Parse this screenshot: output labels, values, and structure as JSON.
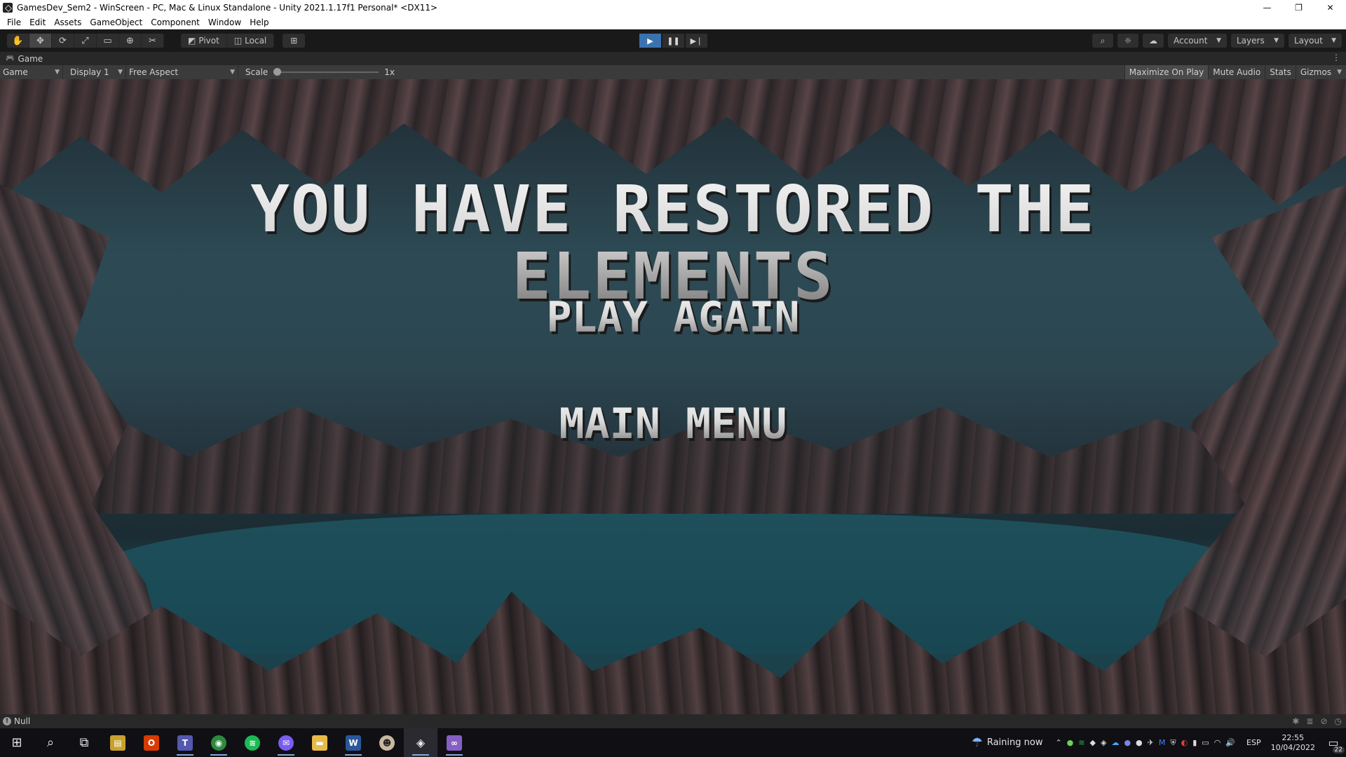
{
  "window": {
    "title": "GamesDev_Sem2 - WinScreen - PC, Mac & Linux Standalone - Unity 2021.1.17f1 Personal* <DX11>",
    "controls": {
      "minimize": "—",
      "restore": "❐",
      "close": "✕"
    }
  },
  "menubar": {
    "items": [
      {
        "label": "File"
      },
      {
        "label": "Edit"
      },
      {
        "label": "Assets"
      },
      {
        "label": "GameObject"
      },
      {
        "label": "Component"
      },
      {
        "label": "Window"
      },
      {
        "label": "Help"
      }
    ]
  },
  "toolbar": {
    "tools": [
      "hand-tool",
      "move-tool",
      "rotate-tool",
      "scale-tool",
      "rect-tool",
      "transform-tool",
      "custom-tool"
    ],
    "tool_glyphs": [
      "✋",
      "✥",
      "⟳",
      "⤢",
      "▭",
      "⊕",
      "✂"
    ],
    "active_tool_index": 1,
    "pivot_label": "Pivot",
    "local_label": "Local",
    "grid_glyph": "⊞",
    "play_glyphs": {
      "play": "▶",
      "pause": "❚❚",
      "step": "▶❘"
    },
    "play_active": true,
    "search_glyph": "⌕",
    "sun_glyph": "☼",
    "cloud_glyph": "☁",
    "account_label": "Account",
    "layers_label": "Layers",
    "layout_label": "Layout"
  },
  "game_tab": {
    "label": "Game",
    "icon": "gamepad-icon",
    "icon_glyph": "🎮",
    "menu_glyph": "⋮"
  },
  "game_controls": {
    "view_mode": "Game",
    "display": "Display 1",
    "aspect": "Free Aspect",
    "scale_label": "Scale",
    "scale_value": "1x",
    "scale_fraction": 0,
    "maximize_label": "Maximize On Play",
    "mute_label": "Mute Audio",
    "stats_label": "Stats",
    "gizmos_label": "Gizmos"
  },
  "game": {
    "headline": "YOU HAVE RESTORED THE ELEMENTS",
    "play_again": "PLAY AGAIN",
    "main_menu": "MAIN MENU"
  },
  "statusbar": {
    "message": "Null",
    "icon_glyph": "!"
  },
  "taskbar": {
    "weather_text": "Raining now",
    "weather_glyph": "☂",
    "language": "ESP",
    "time": "22:55",
    "date": "10/04/2022",
    "notification_count": "22",
    "apps": [
      {
        "name": "start-icon",
        "glyph": "⊞"
      },
      {
        "name": "search-icon",
        "glyph": "⌕"
      },
      {
        "name": "task-view-icon",
        "glyph": "⧉"
      },
      {
        "name": "file-app-icon",
        "glyph": "▤"
      },
      {
        "name": "office-icon",
        "glyph": "O"
      },
      {
        "name": "teams-icon",
        "glyph": "T"
      },
      {
        "name": "chrome-icon",
        "glyph": "◉"
      },
      {
        "name": "spotify-icon",
        "glyph": "≋"
      },
      {
        "name": "messenger-icon",
        "glyph": "✉"
      },
      {
        "name": "file-explorer-icon",
        "glyph": "▬"
      },
      {
        "name": "word-icon",
        "glyph": "W"
      },
      {
        "name": "game-app-icon",
        "glyph": "☻"
      },
      {
        "name": "unity-icon",
        "glyph": "◈"
      },
      {
        "name": "visual-studio-icon",
        "glyph": "∞"
      }
    ],
    "tray_glyphs": [
      "⌃",
      "●",
      "≋",
      "◆",
      "◈",
      "☁",
      "●",
      "●",
      "✈",
      "M",
      "⛨",
      "◐",
      "▮",
      "▭",
      "◠",
      "🔊"
    ]
  },
  "colors": {
    "toolbar_bg": "#191919",
    "play_active": "#3a72b0",
    "water": "#1f5661",
    "rock": "#4f3d3f"
  }
}
